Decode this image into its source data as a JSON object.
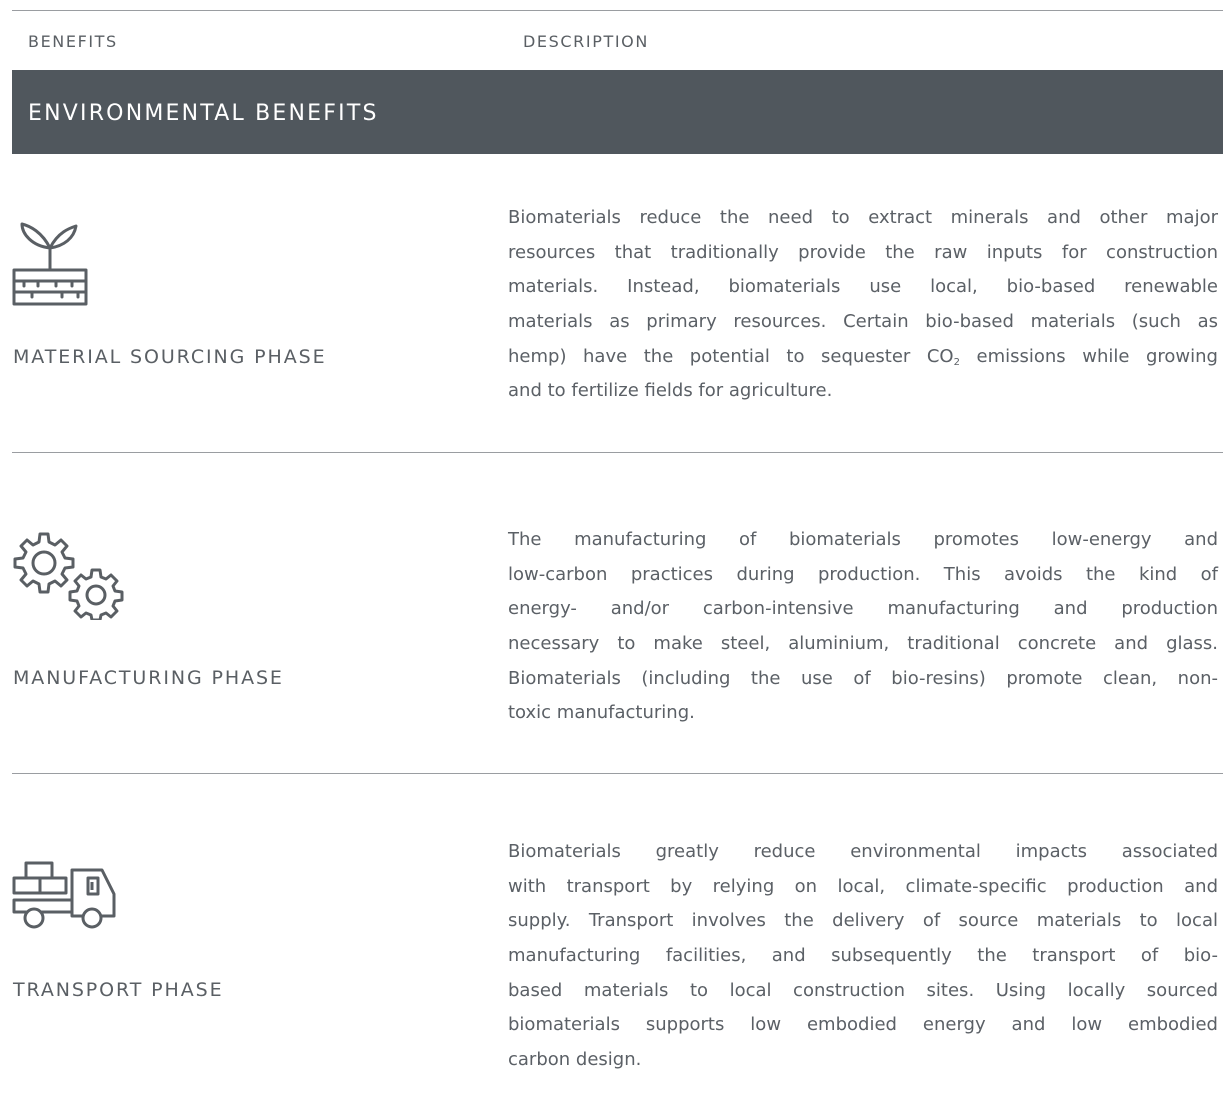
{
  "table": {
    "headers": {
      "benefits": "BENEFITS",
      "description": "DESCRIPTION"
    },
    "section_title": "ENVIRONMENTAL BENEFITS",
    "rows": [
      {
        "icon": "sprout-in-soil-icon",
        "title": "MATERIAL SOURCING PHASE",
        "lines": [
          "Biomaterials reduce the need to extract minerals and other major",
          "resources that traditionally provide the raw inputs for construction",
          "materials. Instead, biomaterials use local, bio-based renewable",
          "materials as primary resources. Certain bio-based materials (such as",
          "hemp) have the potential to sequester CO",
          "2",
          " emissions while growing",
          "and to fertilize fields for agriculture."
        ]
      },
      {
        "icon": "gears-icon",
        "title": "MANUFACTURING PHASE",
        "lines": [
          "The manufacturing of biomaterials promotes low-energy and",
          "low-carbon practices during production. This avoids the kind of",
          "energy- and/or carbon-intensive manufacturing and production",
          "necessary to make steel, aluminium, traditional concrete and glass.",
          "Biomaterials (including the use of bio-resins) promote clean, non-",
          "toxic manufacturing."
        ]
      },
      {
        "icon": "delivery-truck-icon",
        "title": "TRANSPORT PHASE",
        "lines": [
          "Biomaterials greatly reduce environmental impacts associated",
          "with transport by relying on local, climate-specific production and",
          "supply. Transport involves the delivery of source materials to local",
          "manufacturing facilities, and subsequently the transport of bio-",
          "based materials to local construction sites. Using locally sourced",
          "biomaterials supports low embodied energy and low embodied",
          "carbon design."
        ]
      }
    ]
  },
  "colors": {
    "banner": "#50575d",
    "text": "#5b6066",
    "rule": "#9a9da1",
    "banner_text": "#ffffff"
  }
}
